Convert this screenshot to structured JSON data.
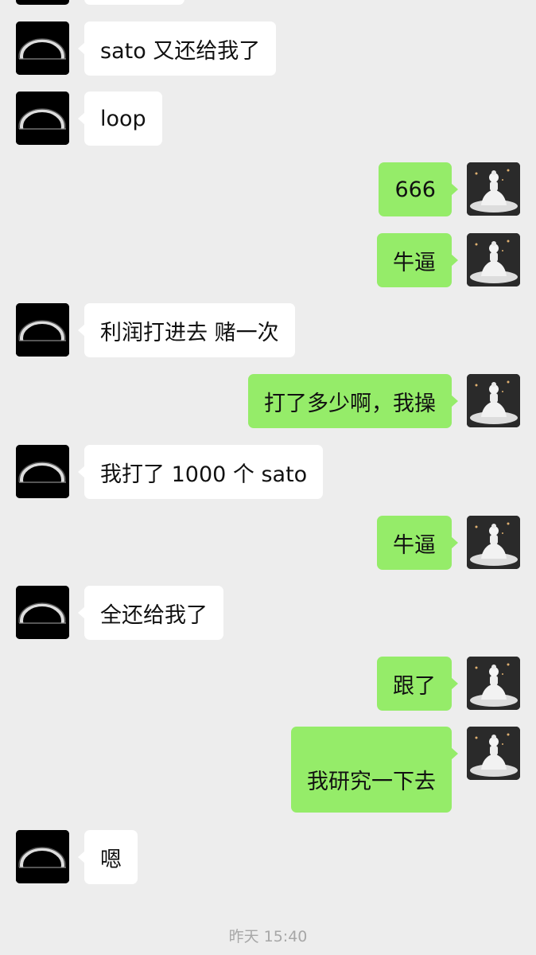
{
  "chat": {
    "messages": [
      {
        "side": "left",
        "text": "sato 又还给我了"
      },
      {
        "side": "left",
        "text": "loop"
      },
      {
        "side": "right",
        "text": "666"
      },
      {
        "side": "right",
        "text": "牛逼"
      },
      {
        "side": "left",
        "text": "利润打进去 赌一次"
      },
      {
        "side": "right",
        "text": "打了多少啊，我操"
      },
      {
        "side": "left",
        "text": "我打了 1000 个 sato"
      },
      {
        "side": "right",
        "text": "牛逼"
      },
      {
        "side": "left",
        "text": "全还给我了"
      },
      {
        "side": "right",
        "text": "跟了"
      },
      {
        "side": "right",
        "text": "我研究一下去"
      },
      {
        "side": "left",
        "text": "嗯"
      }
    ],
    "timestamp": "昨天 15:40"
  },
  "colors": {
    "background": "#ededed",
    "incoming_bubble": "#ffffff",
    "outgoing_bubble": "#95ec69",
    "timestamp_text": "#a7a7a7"
  },
  "icons": {
    "incoming_avatar": "black-hole-avatar-icon",
    "outgoing_avatar": "buddha-statue-avatar-icon"
  }
}
